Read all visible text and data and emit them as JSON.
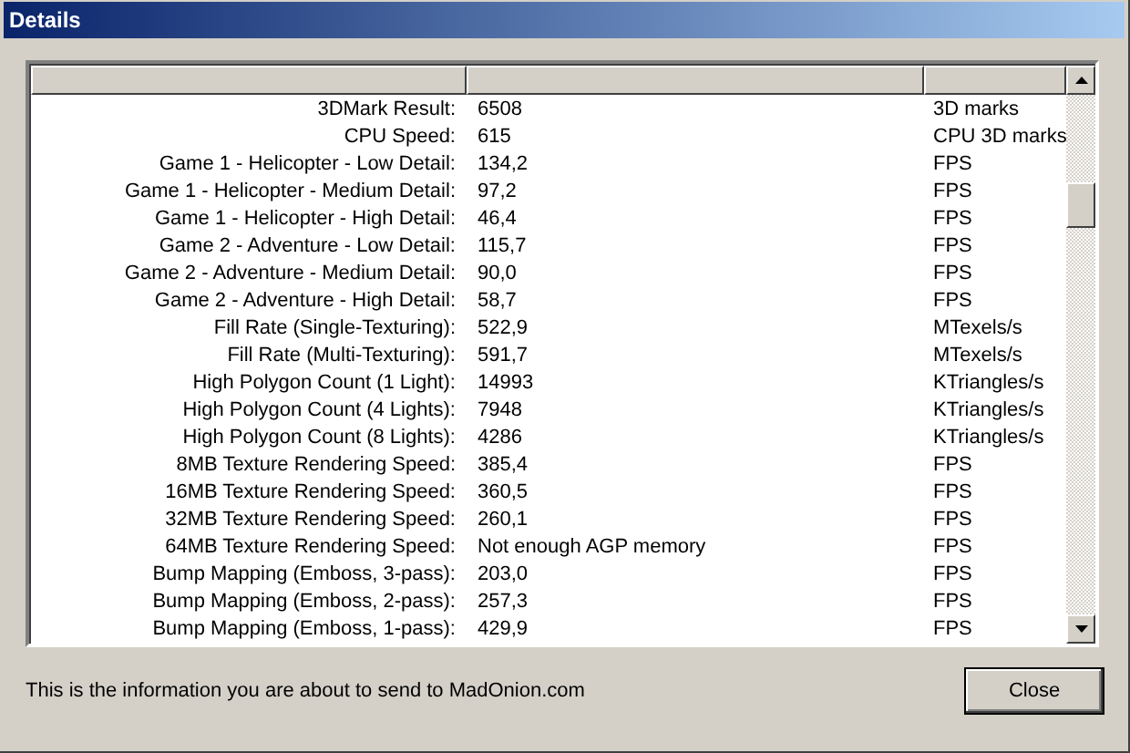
{
  "window": {
    "title": "Details"
  },
  "table": {
    "columns": [
      {},
      {},
      {}
    ],
    "rows": [
      {
        "name": "3DMark Result:",
        "value": "6508",
        "unit": "3D marks"
      },
      {
        "name": "CPU Speed:",
        "value": "615",
        "unit": "CPU 3D marks"
      },
      {
        "name": "Game 1 - Helicopter - Low Detail:",
        "value": "134,2",
        "unit": "FPS"
      },
      {
        "name": "Game 1 - Helicopter - Medium Detail:",
        "value": "97,2",
        "unit": "FPS"
      },
      {
        "name": "Game 1 - Helicopter - High Detail:",
        "value": "46,4",
        "unit": "FPS"
      },
      {
        "name": "Game 2 - Adventure - Low Detail:",
        "value": "115,7",
        "unit": "FPS"
      },
      {
        "name": "Game 2 - Adventure - Medium Detail:",
        "value": "90,0",
        "unit": "FPS"
      },
      {
        "name": "Game 2 - Adventure - High Detail:",
        "value": "58,7",
        "unit": "FPS"
      },
      {
        "name": "Fill Rate (Single-Texturing):",
        "value": "522,9",
        "unit": "MTexels/s"
      },
      {
        "name": "Fill Rate (Multi-Texturing):",
        "value": "591,7",
        "unit": "MTexels/s"
      },
      {
        "name": "High Polygon Count (1 Light):",
        "value": "14993",
        "unit": "KTriangles/s"
      },
      {
        "name": "High Polygon Count (4 Lights):",
        "value": "7948",
        "unit": "KTriangles/s"
      },
      {
        "name": "High Polygon Count (8 Lights):",
        "value": "4286",
        "unit": "KTriangles/s"
      },
      {
        "name": "8MB Texture Rendering Speed:",
        "value": "385,4",
        "unit": "FPS"
      },
      {
        "name": "16MB Texture Rendering Speed:",
        "value": "360,5",
        "unit": "FPS"
      },
      {
        "name": "32MB Texture Rendering Speed:",
        "value": "260,1",
        "unit": "FPS"
      },
      {
        "name": "64MB Texture Rendering Speed:",
        "value": "Not enough AGP memory",
        "unit": "FPS"
      },
      {
        "name": "Bump Mapping (Emboss, 3-pass):",
        "value": "203,0",
        "unit": "FPS"
      },
      {
        "name": "Bump Mapping (Emboss, 2-pass):",
        "value": "257,3",
        "unit": "FPS"
      },
      {
        "name": "Bump Mapping (Emboss, 1-pass):",
        "value": "429,9",
        "unit": "FPS"
      }
    ]
  },
  "footer": {
    "text": "This is the information you are about to send to MadOnion.com"
  },
  "buttons": [
    {
      "label": "Close"
    }
  ]
}
